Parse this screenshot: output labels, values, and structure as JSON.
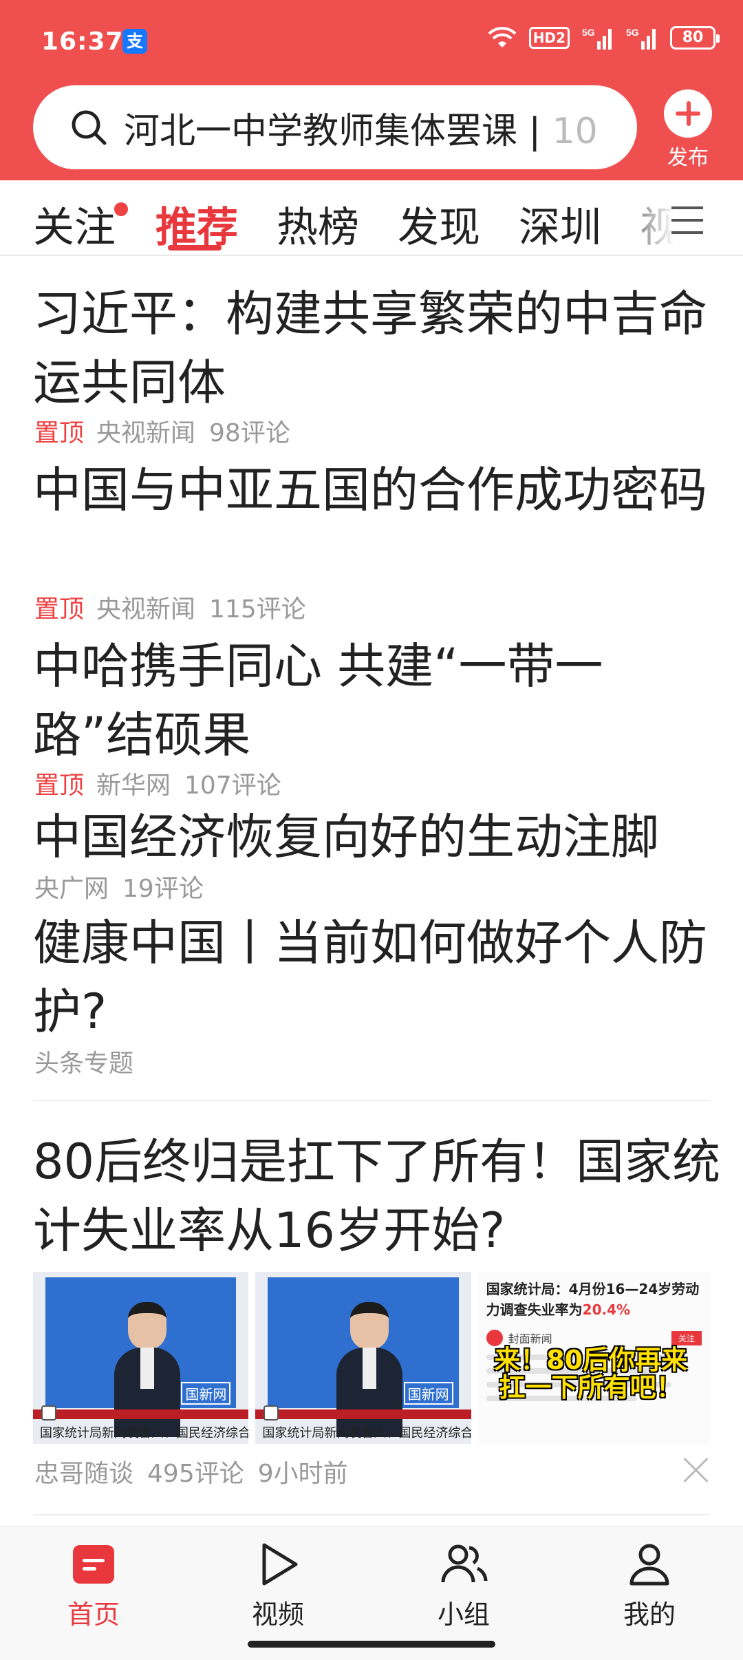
{
  "status_bar": {
    "time": "16:37",
    "app_badge": "支",
    "hd_badge": "HD2",
    "battery": "80"
  },
  "search": {
    "query": "河北一中学教师集体罢课 | ",
    "overflow": "10"
  },
  "publish": {
    "label": "发布"
  },
  "tabs": [
    {
      "label": "关注"
    },
    {
      "label": "推荐"
    },
    {
      "label": "热榜"
    },
    {
      "label": "发现"
    },
    {
      "label": "深圳"
    },
    {
      "label": "视"
    }
  ],
  "feed": [
    {
      "title": "习近平：构建共享繁荣的中吉命运共同体",
      "pinned": "置顶",
      "source": "央视新闻",
      "comments": "98评论"
    },
    {
      "title": "中国与中亚五国的合作成功密码",
      "pinned": "置顶",
      "source": "央视新闻",
      "comments": "115评论"
    },
    {
      "title": "中哈携手同心 共建“一带一路”结硕果",
      "pinned": "置顶",
      "source": "新华网",
      "comments": "107评论"
    },
    {
      "title": "中国经济恢复向好的生动注脚",
      "source": "央广网",
      "comments": "19评论"
    },
    {
      "title": "健康中国丨当前如何做好个人防护?",
      "source": "头条专题"
    }
  ],
  "article": {
    "title": "80后终归是扛下了所有！国家统计失业率从16岁开始?",
    "source": "忠哥随谈",
    "comments": "495评论",
    "time": "9小时前",
    "thumbs": {
      "caption": "国家统计局新闻发言人、国民经济综合统计司",
      "press_logo": "国新网",
      "doc_title_a": "国家统计局：4月份16—24岁劳动力调查失业率为",
      "doc_title_b": "20.4%",
      "doc_source": "封面新闻",
      "doc_follow": "关注",
      "overlay": "来！80后你再来扛一下所有吧！"
    }
  },
  "bottom_nav": [
    {
      "label": "首页"
    },
    {
      "label": "视频"
    },
    {
      "label": "小组"
    },
    {
      "label": "我的"
    }
  ],
  "colors": {
    "brand_red": "#f04f50",
    "active_red": "#e8383d"
  }
}
